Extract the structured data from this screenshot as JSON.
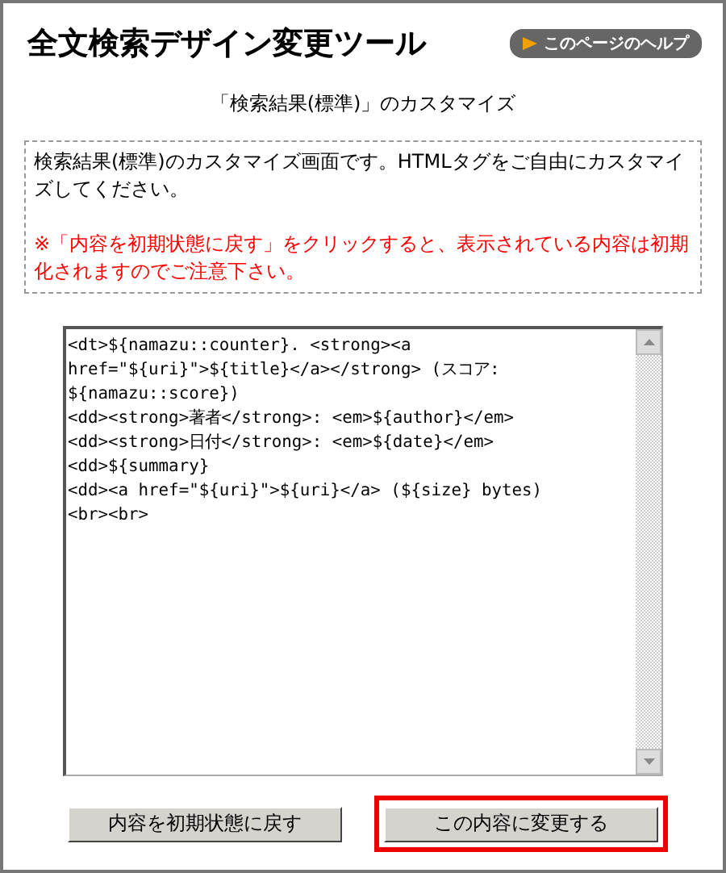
{
  "title": "全文検索デザイン変更ツール",
  "help_button": {
    "label": "このページのヘルプ"
  },
  "subtitle": "「検索結果(標準)」のカスタマイズ",
  "notice": {
    "description": "検索結果(標準)のカスタマイズ画面です。HTMLタグをご自由にカスタマイズしてください。",
    "warning": "※「内容を初期状態に戻す」をクリックすると、表示されている内容は初期化されますのでご注意下さい。"
  },
  "editor": {
    "lines": [
      "<dt>${namazu::counter}. <strong><a",
      "href=\"${uri}\">${title}</a></strong> (スコア:",
      "${namazu::score})",
      "<dd><strong>著者</strong>: <em>${author}</em>",
      "<dd><strong>日付</strong>: <em>${date}</em>",
      "<dd>${summary}",
      "<dd><a href=\"${uri}\">${uri}</a> (${size} bytes)",
      "<br><br>"
    ]
  },
  "buttons": [
    {
      "label": "内容を初期状態に戻す",
      "highlighted": false
    },
    {
      "label": "この内容に変更する",
      "highlighted": true
    }
  ]
}
